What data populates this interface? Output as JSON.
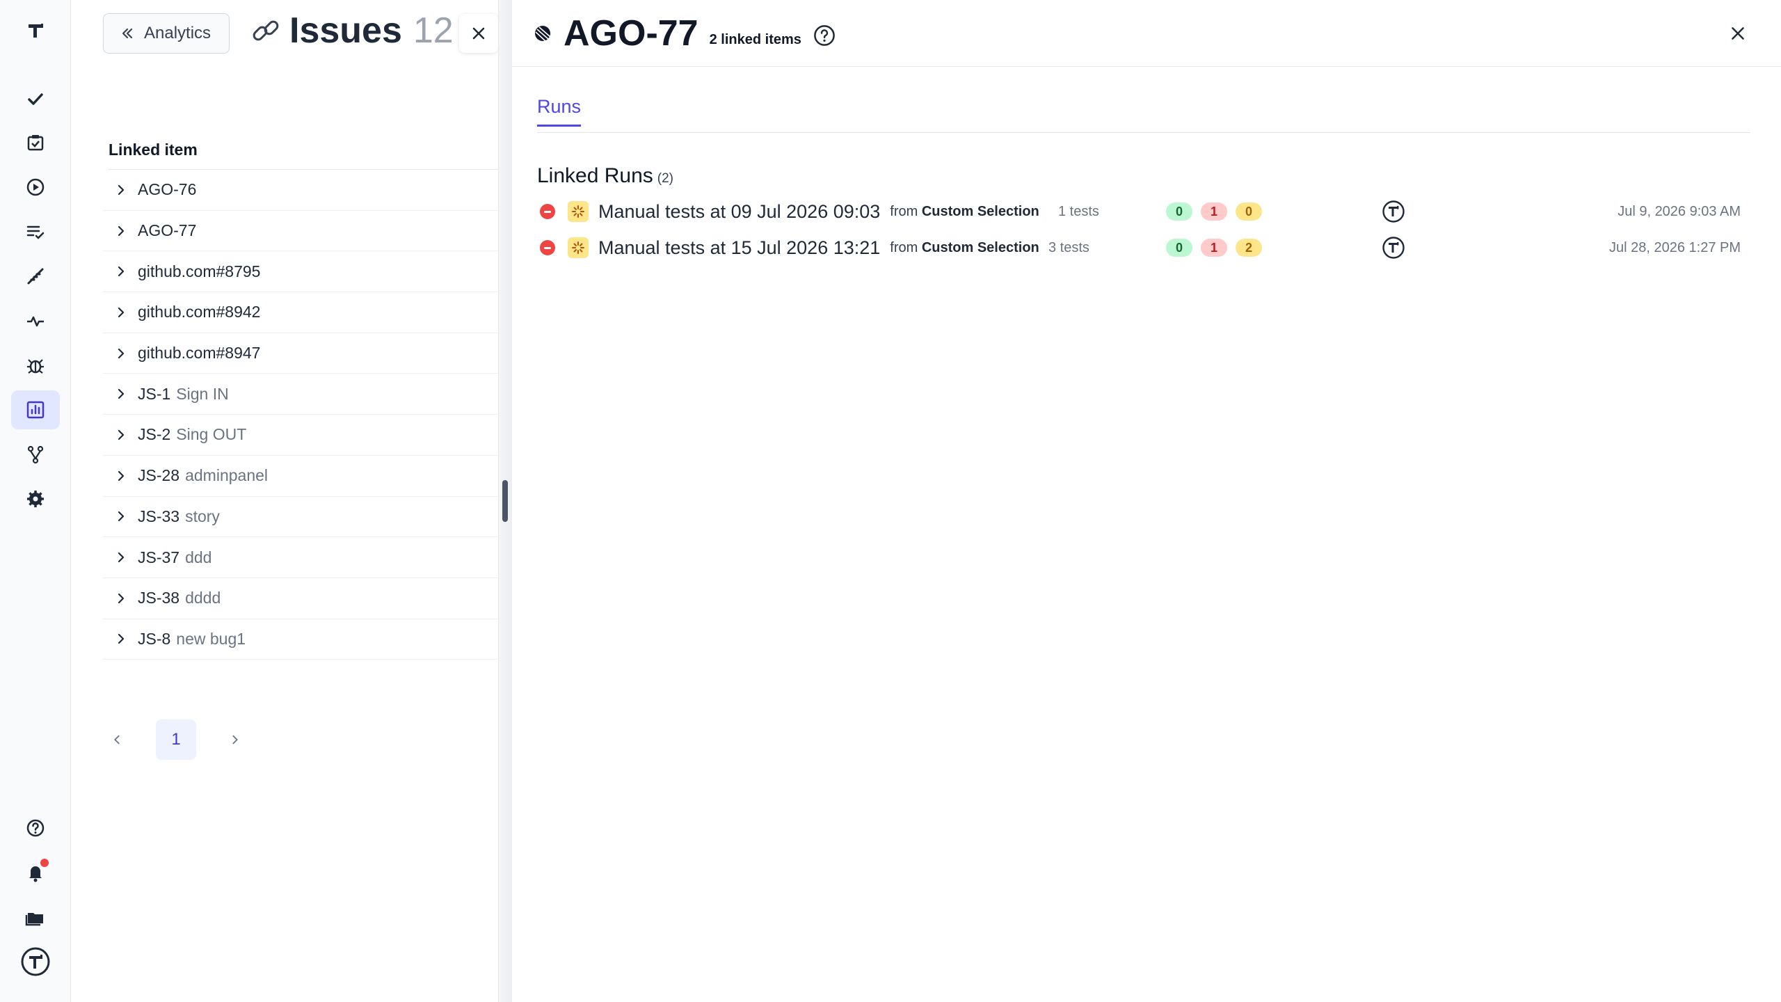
{
  "sidebar": {
    "items": [
      {
        "name": "logo-icon"
      },
      {
        "name": "checkmark-icon"
      },
      {
        "name": "clipboard-check-icon"
      },
      {
        "name": "play-circle-icon"
      },
      {
        "name": "list-check-icon"
      },
      {
        "name": "steps-icon"
      },
      {
        "name": "pulse-icon"
      },
      {
        "name": "bug-icon"
      },
      {
        "name": "analytics-icon",
        "active": true
      },
      {
        "name": "git-branch-icon"
      },
      {
        "name": "gear-icon"
      }
    ],
    "bottom": [
      {
        "name": "help-icon"
      },
      {
        "name": "bell-icon",
        "has_notification": true
      },
      {
        "name": "folder-icon"
      },
      {
        "name": "avatar-icon"
      }
    ]
  },
  "left_panel": {
    "back_label": "Analytics",
    "title": "Issues",
    "count": "12",
    "column_header": "Linked item",
    "items": [
      {
        "id": "AGO-76",
        "desc": ""
      },
      {
        "id": "AGO-77",
        "desc": ""
      },
      {
        "id": "github.com#8795",
        "desc": ""
      },
      {
        "id": "github.com#8942",
        "desc": ""
      },
      {
        "id": "github.com#8947",
        "desc": ""
      },
      {
        "id": "JS-1",
        "desc": "Sign IN"
      },
      {
        "id": "JS-2",
        "desc": "Sing OUT"
      },
      {
        "id": "JS-28",
        "desc": "adminpanel"
      },
      {
        "id": "JS-33",
        "desc": "story"
      },
      {
        "id": "JS-37",
        "desc": "ddd"
      },
      {
        "id": "JS-38",
        "desc": "dddd"
      },
      {
        "id": "JS-8",
        "desc": "new bug1"
      }
    ],
    "pagination": {
      "current": "1"
    }
  },
  "detail": {
    "title": "AGO-77",
    "linked_items": "2 linked items",
    "tab": "Runs",
    "section_title": "Linked Runs",
    "section_count": "(2)",
    "runs": [
      {
        "title": "Manual tests at 09 Jul 2026 09:03",
        "from_prefix": "from",
        "from_source": "Custom Selection",
        "tests": "1 tests",
        "passed": "0",
        "failed": "1",
        "skipped": "0",
        "date": "Jul 9, 2026 9:03 AM"
      },
      {
        "title": "Manual tests at 15 Jul 2026 13:21",
        "from_prefix": "from",
        "from_source": "Custom Selection",
        "tests": "3 tests",
        "passed": "0",
        "failed": "1",
        "skipped": "2",
        "date": "Jul 28, 2026 1:27 PM"
      }
    ]
  },
  "colors": {
    "accent": "#4f46e5",
    "failed": "#ef4444",
    "passed_bg": "#bbf7d0",
    "failed_bg": "#fecaca",
    "skipped_bg": "#fde68a"
  }
}
